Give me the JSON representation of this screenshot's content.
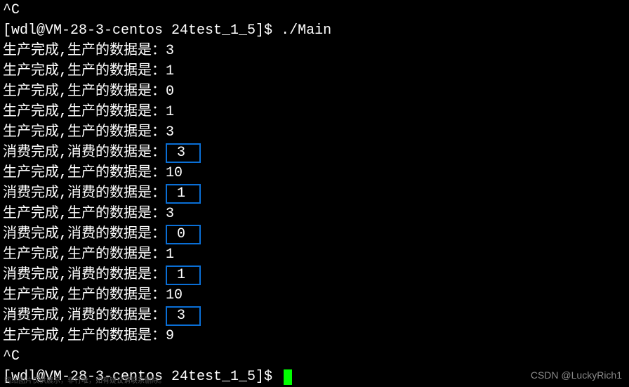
{
  "lines": [
    {
      "t": "plain",
      "text": "^C"
    },
    {
      "t": "prompt",
      "user_host": "[wdl@VM-28-3-centos 24test_1_5]$ ",
      "cmd": "./Main"
    },
    {
      "t": "prod",
      "label": "生产完成,生产的数据是：",
      "value": "3"
    },
    {
      "t": "prod",
      "label": "生产完成,生产的数据是：",
      "value": "1"
    },
    {
      "t": "prod",
      "label": "生产完成,生产的数据是：",
      "value": "0"
    },
    {
      "t": "prod",
      "label": "生产完成,生产的数据是：",
      "value": "1"
    },
    {
      "t": "prod",
      "label": "生产完成,生产的数据是：",
      "value": "3"
    },
    {
      "t": "cons",
      "label": "消费完成,消费的数据是：",
      "value": "3"
    },
    {
      "t": "prod",
      "label": "生产完成,生产的数据是：",
      "value": "10"
    },
    {
      "t": "cons",
      "label": "消费完成,消费的数据是：",
      "value": "1"
    },
    {
      "t": "prod",
      "label": "生产完成,生产的数据是：",
      "value": "3"
    },
    {
      "t": "cons",
      "label": "消费完成,消费的数据是：",
      "value": "0"
    },
    {
      "t": "prod",
      "label": "生产完成,生产的数据是：",
      "value": "1"
    },
    {
      "t": "cons",
      "label": "消费完成,消费的数据是：",
      "value": "1"
    },
    {
      "t": "prod",
      "label": "生产完成,生产的数据是：",
      "value": "10"
    },
    {
      "t": "cons",
      "label": "消费完成,消费的数据是：",
      "value": "3"
    },
    {
      "t": "prod",
      "label": "生产完成,生产的数据是：",
      "value": "9"
    },
    {
      "t": "plain",
      "text": "^C"
    },
    {
      "t": "prompt_cursor",
      "user_host": "[wdl@VM-28-3-centos 24test_1_5]$ "
    }
  ],
  "watermark": "CSDN @LuckyRich1",
  "subtext": "网络图片仅供展示，非行唯，如有疑议请联系删除。"
}
